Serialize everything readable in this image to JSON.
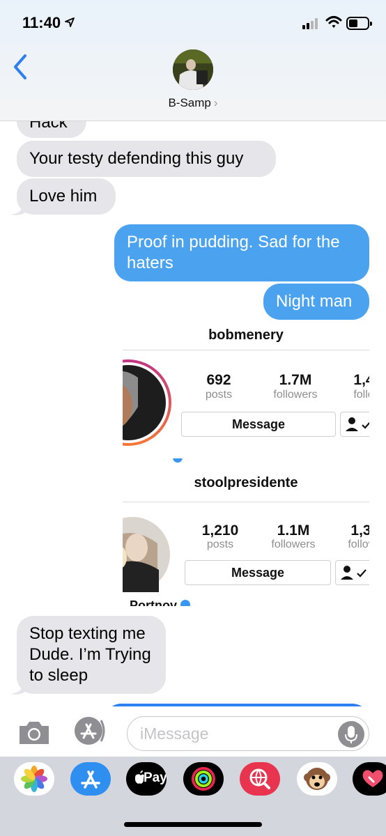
{
  "status": {
    "time": "11:40"
  },
  "header": {
    "contact_name": "B-Samp",
    "chevron": "›"
  },
  "messages": {
    "partial_top": "Hack",
    "m1": "Your testy defending this guy",
    "m2": "Love him",
    "m3": "Proof in pudding. Sad for the haters",
    "m4": "Night man",
    "m5": "Stop texting me Dude. I’m Trying to sleep"
  },
  "cards": [
    {
      "username": "bobmenery",
      "posts": "692",
      "posts_label": "posts",
      "followers": "1.7M",
      "followers_label": "followers",
      "following": "1,4",
      "following_label": "follo",
      "button": "Message"
    },
    {
      "username": "stoolpresidente",
      "posts": "1,210",
      "posts_label": "posts",
      "followers": "1.1M",
      "followers_label": "followers",
      "following": "1,3",
      "following_label": "follov",
      "button": "Message",
      "name_partial": "Portnov"
    }
  ],
  "input": {
    "placeholder": "iMessage"
  },
  "drawer": {
    "apps": [
      "photos-icon",
      "app-store-icon",
      "apple-pay-icon",
      "activity-icon",
      "web-search-icon",
      "animoji-icon",
      "digital-touch-icon"
    ],
    "apple_pay_label": "Pay"
  },
  "colors": {
    "outgoing": "#4ba3ef",
    "incoming": "#e5e5ea",
    "drawer": "#d3d6dc"
  }
}
